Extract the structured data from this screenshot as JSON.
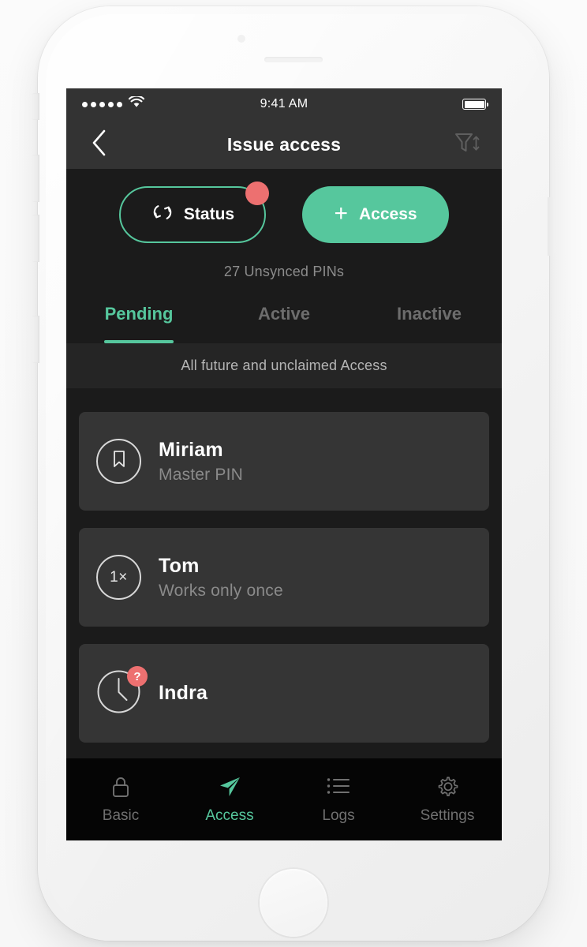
{
  "status_bar": {
    "time": "9:41 AM",
    "signal_icon": "signal-dots-icon",
    "wifi_icon": "wifi-icon",
    "battery_icon": "battery-full-icon"
  },
  "nav": {
    "back_icon": "chevron-left-icon",
    "title": "Issue access",
    "filter_icon": "filter-sort-icon"
  },
  "actions": {
    "status_button": {
      "label": "Status",
      "icon": "sync-icon",
      "badge": "notification-dot"
    },
    "access_button": {
      "label": "Access",
      "icon": "plus-icon"
    },
    "unsynced_text": "27 Unsynced PINs"
  },
  "tabs": [
    {
      "label": "Pending",
      "active": true
    },
    {
      "label": "Active",
      "active": false
    },
    {
      "label": "Inactive",
      "active": false
    }
  ],
  "subtitle": "All future and unclaimed Access",
  "list": [
    {
      "title": "Miriam",
      "subtitle": "Master PIN",
      "icon": "bookmark-icon",
      "badge": null
    },
    {
      "title": "Tom",
      "subtitle": "Works only once",
      "icon": "one-times-icon",
      "icon_text": "1×",
      "badge": null
    },
    {
      "title": "Indra",
      "subtitle": "",
      "icon": "clock-icon",
      "badge": "?"
    }
  ],
  "tabbar": [
    {
      "label": "Basic",
      "icon": "lock-icon",
      "active": false
    },
    {
      "label": "Access",
      "icon": "paper-plane-icon",
      "active": true
    },
    {
      "label": "Logs",
      "icon": "list-icon",
      "active": false
    },
    {
      "label": "Settings",
      "icon": "gear-icon",
      "active": false
    }
  ],
  "colors": {
    "accent_green": "#56c79d",
    "badge_red": "#ed7070",
    "screen_bg": "#1b1b1b",
    "card_bg": "#353535",
    "navbar_bg": "#333333",
    "tabbar_bg": "#050505"
  }
}
